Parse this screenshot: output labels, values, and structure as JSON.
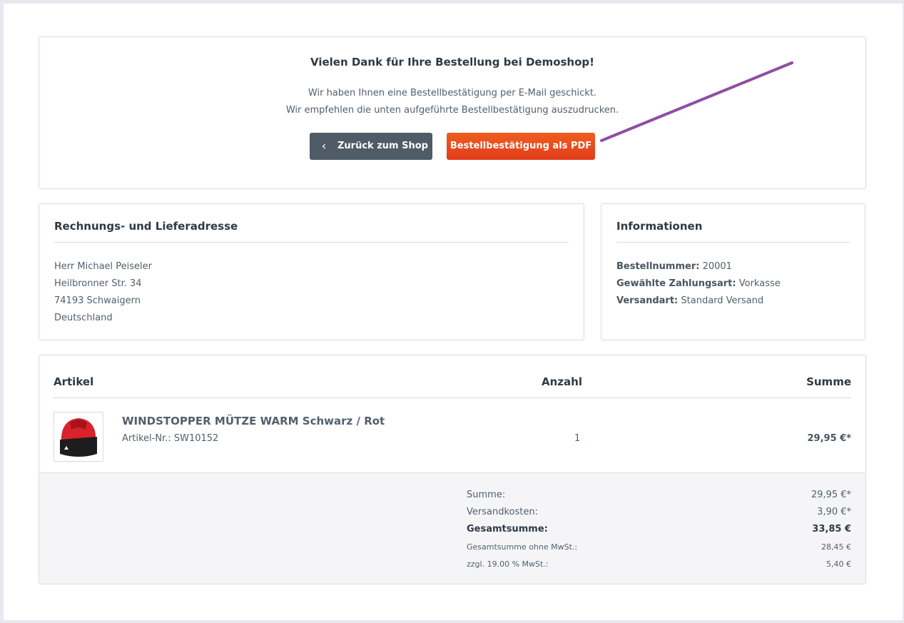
{
  "thanks": {
    "title": "Vielen Dank für Ihre Bestellung bei Demoshop!",
    "line1": "Wir haben Ihnen eine Bestellbestätigung per E-Mail geschickt.",
    "line2": "Wir empfehlen die unten aufgeführte Bestellbestätigung auszudrucken.",
    "back_label": "Zurück zum Shop",
    "pdf_label": "Bestellbestätigung als PDF"
  },
  "address": {
    "title": "Rechnungs- und Lieferadresse",
    "lines": [
      "Herr Michael Peiseler",
      "Heilbronner Str. 34",
      "74193 Schwaigern",
      "Deutschland"
    ]
  },
  "info": {
    "title": "Informationen",
    "order_no_label": "Bestellnummer:",
    "order_no": "20001",
    "payment_label": "Gewählte Zahlungsart:",
    "payment": "Vorkasse",
    "shipping_label": "Versandart:",
    "shipping": "Standard Versand"
  },
  "cart": {
    "col_article": "Artikel",
    "col_qty": "Anzahl",
    "col_sum": "Summe",
    "item": {
      "name": "WINDSTOPPER MÜTZE WARM Schwarz / Rot",
      "number": "Artikel-Nr.: SW10152",
      "qty": "1",
      "price": "29,95 €*"
    },
    "totals": [
      {
        "label": "Summe:",
        "value": "29,95 €*"
      },
      {
        "label": "Versandkosten:",
        "value": "3,90 €*"
      },
      {
        "label": "Gesamtsumme:",
        "value": "33,85 €"
      },
      {
        "label": "Gesamtsumme ohne MwSt.:",
        "value": "28,45 €"
      },
      {
        "label": "zzgl. 19.00 % MwSt.:",
        "value": "5,40 €"
      }
    ]
  },
  "colors": {
    "pdf_button": "#e8481c",
    "back_button": "#4f5b67",
    "annotation_arrow": "#8e4ea3"
  },
  "icons": {
    "back": "chevron-left-icon",
    "product": "beanie-hat-image"
  }
}
